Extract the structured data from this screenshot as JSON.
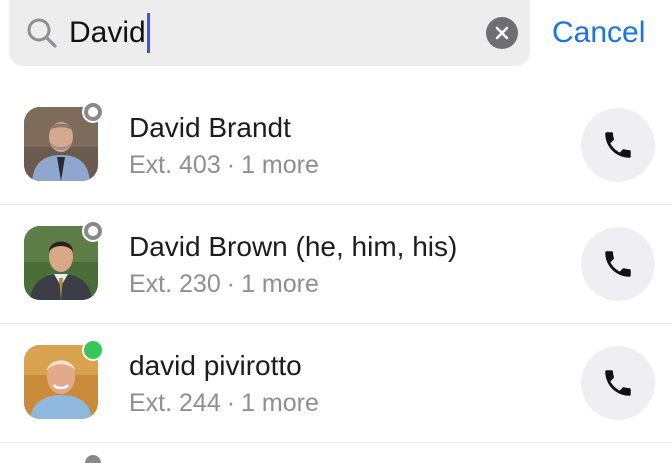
{
  "search": {
    "value": "David",
    "cancel_label": "Cancel"
  },
  "results": [
    {
      "name": "David Brandt",
      "ext": "Ext. 403",
      "separator": "·",
      "more": "1 more",
      "presence": "offline"
    },
    {
      "name": "David Brown (he, him, his)",
      "ext": "Ext. 230",
      "separator": "·",
      "more": "1 more",
      "presence": "offline"
    },
    {
      "name": "david pivirotto",
      "ext": "Ext. 244",
      "separator": "·",
      "more": "1 more",
      "presence": "online"
    }
  ],
  "colors": {
    "accent": "#1a73e8",
    "online": "#34c759",
    "offline": "#8a8a8e"
  },
  "icons": {
    "search": "search-icon",
    "clear": "clear-icon",
    "call": "phone-icon"
  }
}
